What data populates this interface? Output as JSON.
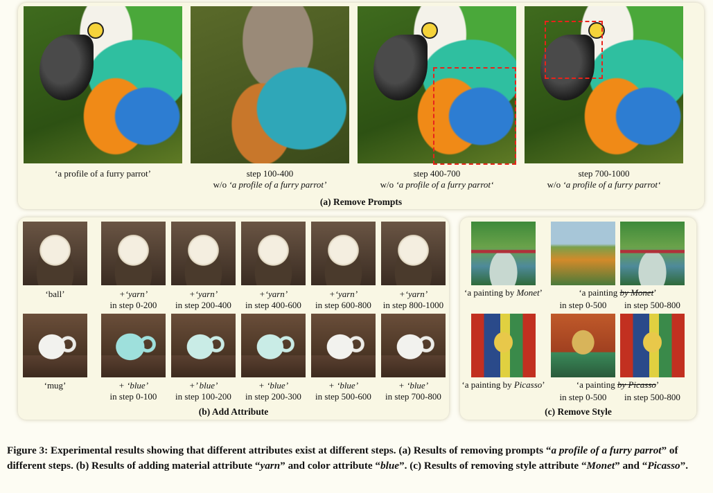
{
  "panel_a": {
    "title": "(a) Remove Prompts",
    "captions": [
      {
        "line1": "‘a profile of a furry parrot’",
        "line2": ""
      },
      {
        "line1": "step 100-400",
        "line2_pre": "w/o ",
        "line2_it": "‘a profile of a furry parrot’"
      },
      {
        "line1": "step 400-700",
        "line2_pre": "w/o ",
        "line2_it": "‘a profile of a furry parrot‘"
      },
      {
        "line1": "step 700-1000",
        "line2_pre": "w/o ",
        "line2_it": "‘a profile of a furry parrot‘"
      }
    ]
  },
  "panel_b": {
    "title": "(b) Add Attribute",
    "ball_base": "‘ball’",
    "yarn_label": "+‘yarn’",
    "yarn_steps": [
      "in step 0-200",
      "in step 200-400",
      "in step 400-600",
      "in step 600-800",
      "in step 800-1000"
    ],
    "mug_base": "‘mug’",
    "blue_labels": [
      "+ ‘blue’",
      "+’ blue’",
      "+ ‘blue’",
      "+ ‘blue’",
      "+ ‘blue’"
    ],
    "blue_steps": [
      "in step 0-100",
      "in step 100-200",
      "in step 200-300",
      "in step 500-600",
      "in step 700-800"
    ]
  },
  "panel_c": {
    "title": "(c) Remove Style",
    "monet_base_pre": "‘a painting by ",
    "monet_base_it": "Monet",
    "monet_base_post": "’",
    "monet_removed_pre": "‘a painting ",
    "monet_removed_strike": "by Monet",
    "monet_removed_post": "’",
    "monet_steps": [
      "in step 0-500",
      "in step 500-800"
    ],
    "picasso_base_pre": "‘a painting by ",
    "picasso_base_it": "Picasso",
    "picasso_base_post": "’",
    "picasso_removed_pre": "‘a painting ",
    "picasso_removed_strike": "by Picasso",
    "picasso_removed_post": "’",
    "picasso_steps": [
      "in step 0-500",
      "in step 500-800"
    ]
  },
  "figure_caption": {
    "p1": "Figure 3: Experimental results showing that different attributes exist at different steps. (a) Results of removing prompts “",
    "i1": "a profile of a furry parrot",
    "p2": "” of different steps. (b) Results of adding material attribute “",
    "i2": "yarn",
    "p3": "” and color attribute “",
    "i3": "blue",
    "p4": "”. (c) Results of removing style attribute “",
    "i4": "Monet",
    "p5": "” and “",
    "i5": "Picasso",
    "p6": "”."
  },
  "colors": {
    "highlight_box": "#e8231b",
    "panel_bg": "#f9f7e4"
  }
}
